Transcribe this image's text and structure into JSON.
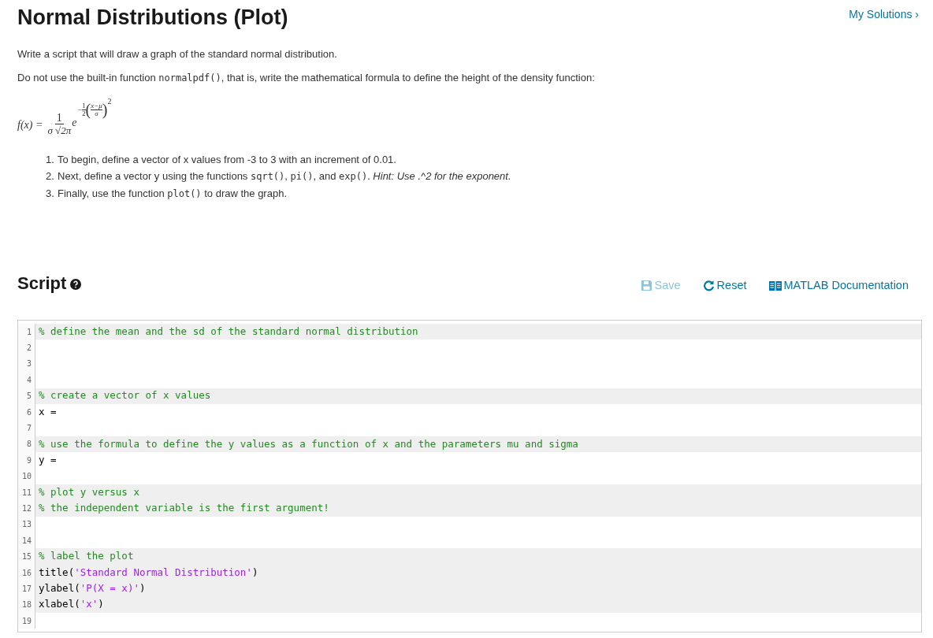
{
  "header": {
    "title": "Normal Distributions (Plot)",
    "link": "My Solutions ›"
  },
  "description": [
    [
      {
        "kind": "text",
        "text": "Write a script that will draw a graph of the standard normal distribution."
      }
    ],
    [
      {
        "kind": "text",
        "text": "Do not use the built-in function "
      },
      {
        "kind": "code",
        "text": "normalpdf()"
      },
      {
        "kind": "text",
        "text": ", that is, write the mathematical formula to define the height of the density function:"
      }
    ]
  ],
  "formula": {
    "lhs": "f(x) =",
    "numerator": "1",
    "denominator": "σ √2π",
    "base": "e",
    "sign": "−",
    "half_num": "1",
    "half_den": "2",
    "open": "(",
    "frac_num": "x−μ",
    "frac_den": "σ",
    "close": ")",
    "power": "2"
  },
  "steps": [
    {
      "number": "1.",
      "parts": [
        {
          "kind": "text",
          "text": "To begin, define a vector of x values from -3 to 3 with an increment of 0.01."
        }
      ]
    },
    {
      "number": "2.",
      "parts": [
        {
          "kind": "text",
          "text": "Next, define a vector y using the functions "
        },
        {
          "kind": "code",
          "text": "sqrt()"
        },
        {
          "kind": "text",
          "text": ", "
        },
        {
          "kind": "code",
          "text": "pi()"
        },
        {
          "kind": "text",
          "text": ", and "
        },
        {
          "kind": "code",
          "text": "exp()"
        },
        {
          "kind": "text",
          "text": ". "
        },
        {
          "kind": "italic",
          "text": "Hint: Use .^2 for the exponent."
        }
      ]
    },
    {
      "number": "3.",
      "parts": [
        {
          "kind": "text",
          "text": "Finally, use the function "
        },
        {
          "kind": "code",
          "text": "plot()"
        },
        {
          "kind": "text",
          "text": " to draw the graph."
        }
      ]
    }
  ],
  "script": {
    "title": "Script",
    "actions": [
      {
        "kind": "save",
        "label": "Save",
        "disabled": true
      },
      {
        "kind": "reset",
        "label": "Reset",
        "disabled": false
      },
      {
        "kind": "docs",
        "label": "MATLAB Documentation",
        "disabled": false
      }
    ],
    "lines": [
      {
        "number": "1",
        "shaded": true,
        "parts": [
          {
            "kind": "comment",
            "text": "% define the mean and the sd of the standard normal distribution"
          }
        ]
      },
      {
        "number": "2",
        "shaded": false
      },
      {
        "number": "3",
        "shaded": false
      },
      {
        "number": "4",
        "shaded": false
      },
      {
        "number": "5",
        "shaded": true,
        "parts": [
          {
            "kind": "comment",
            "text": "% create a vector of x values"
          }
        ]
      },
      {
        "number": "6",
        "shaded": false,
        "parts": [
          {
            "kind": "code",
            "text": "x ="
          }
        ]
      },
      {
        "number": "7",
        "shaded": false
      },
      {
        "number": "8",
        "shaded": true,
        "parts": [
          {
            "kind": "comment",
            "text": "% use the formula to define the y values as a function of x and the parameters mu and sigma"
          }
        ]
      },
      {
        "number": "9",
        "shaded": false,
        "parts": [
          {
            "kind": "code",
            "text": "y ="
          }
        ]
      },
      {
        "number": "10",
        "shaded": false
      },
      {
        "number": "11",
        "shaded": true,
        "parts": [
          {
            "kind": "comment",
            "text": "% plot y versus x"
          }
        ]
      },
      {
        "number": "12",
        "shaded": true,
        "parts": [
          {
            "kind": "comment",
            "text": "% the independent variable is the first argument!"
          }
        ]
      },
      {
        "number": "13",
        "shaded": false
      },
      {
        "number": "14",
        "shaded": false
      },
      {
        "number": "15",
        "shaded": true,
        "parts": [
          {
            "kind": "comment",
            "text": "% label the plot"
          }
        ]
      },
      {
        "number": "16",
        "shaded": true,
        "parts": [
          {
            "kind": "code",
            "text": "title("
          },
          {
            "kind": "string",
            "text": "'Standard Normal Distribution'"
          },
          {
            "kind": "code",
            "text": ")"
          }
        ]
      },
      {
        "number": "17",
        "shaded": true,
        "parts": [
          {
            "kind": "code",
            "text": "ylabel("
          },
          {
            "kind": "string",
            "text": "'P(X = x)'"
          },
          {
            "kind": "code",
            "text": ")"
          }
        ]
      },
      {
        "number": "18",
        "shaded": true,
        "parts": [
          {
            "kind": "code",
            "text": "xlabel("
          },
          {
            "kind": "string",
            "text": "'x'"
          },
          {
            "kind": "code",
            "text": ")"
          }
        ]
      },
      {
        "number": "19",
        "shaded": false
      }
    ]
  }
}
